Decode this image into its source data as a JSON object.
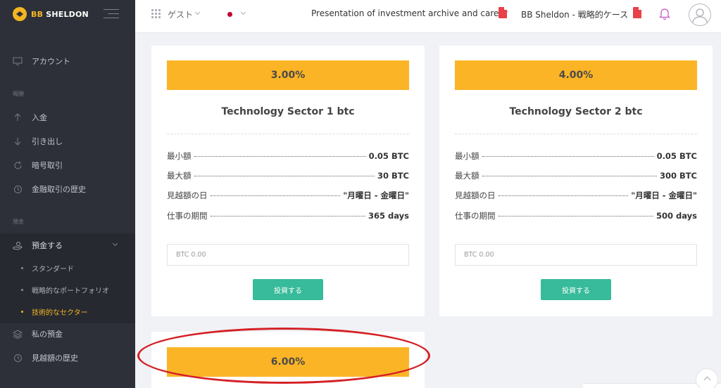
{
  "brand": {
    "logo_prefix": "BB",
    "logo_name": "SHELDON",
    "accent": "#f3b522"
  },
  "sidebar": {
    "account": "アカウント",
    "section_finance": "報酬",
    "finance_items": [
      "入金",
      "引き出し",
      "暗号取引",
      "金融取引の歴史"
    ],
    "section_deposit": "預金",
    "deposit_menu": "預金する",
    "deposit_sub": [
      "スタンダード",
      "戦略的なポートフォリオ",
      "技術的なセクター"
    ],
    "active_sub": "技術的なセクター",
    "my_deposit": "私の預金",
    "profit_history": "見越額の歴史"
  },
  "topbar": {
    "user": "ゲスト",
    "link1": "Presentation of investment archive and career",
    "link2": "BB Sheldon - 戦略的ケース"
  },
  "labels": {
    "min": "最小額",
    "max": "最大額",
    "accrual_day": "見越額の日",
    "period": "仕事の期間",
    "placeholder": "BTC 0.00",
    "invest": "投資する"
  },
  "plans": [
    {
      "rate": "3.00%",
      "title": "Technology Sector 1 btc",
      "min": "0.05 BTC",
      "max": "30 BTC",
      "days": "\"月曜日 - 金曜日\"",
      "period": "365 days"
    },
    {
      "rate": "4.00%",
      "title": "Technology Sector 2 btc",
      "min": "0.05 BTC",
      "max": "300 BTC",
      "days": "\"月曜日 - 金曜日\"",
      "period": "500 days"
    },
    {
      "rate": "6.00%"
    }
  ]
}
